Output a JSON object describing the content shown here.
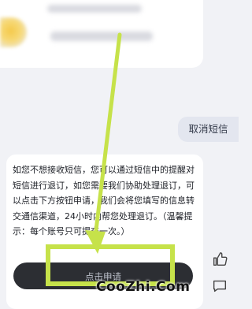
{
  "conversation": {
    "user_message": "取消短信",
    "reply": {
      "text": "如您不想接收短信，您可以通过短信中的提醒对短信进行退订，如您需要我们协助处理退订，可以点击下方按钮申请，我们会将您填写的信息转交通信渠道，24小时内帮您处理退订。（温馨提示：每个账号只可提交一次。）",
      "button_label": "点击申请"
    }
  },
  "icons": {
    "like": "thumbs-up-icon",
    "comment": "comment-icon"
  },
  "annotation": {
    "color": "#c6e24a"
  },
  "watermark": "CooZhi.Com"
}
